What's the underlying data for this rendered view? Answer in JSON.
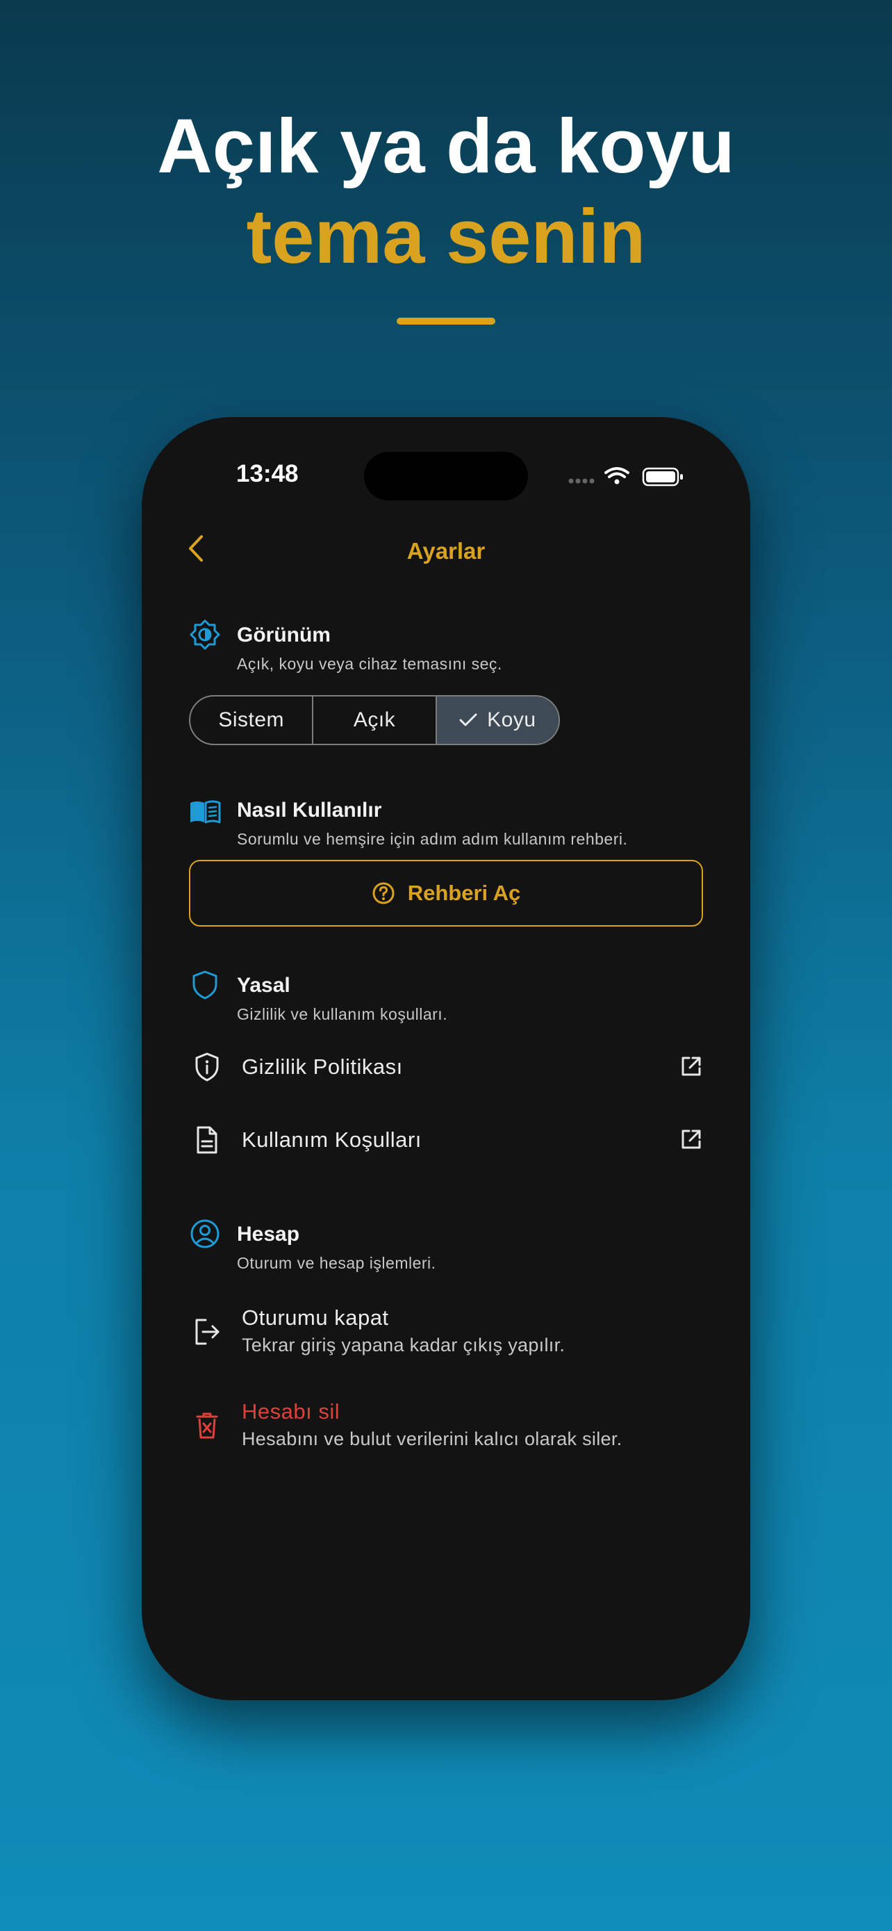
{
  "hero": {
    "line1": "Açık ya da koyu",
    "line2": "tema senin"
  },
  "status_bar": {
    "time": "13:48"
  },
  "nav": {
    "title": "Ayarlar"
  },
  "appearance": {
    "title": "Görünüm",
    "subtitle": "Açık, koyu veya cihaz temasını seç.",
    "options": [
      "Sistem",
      "Açık",
      "Koyu"
    ],
    "selected": "Koyu"
  },
  "howto": {
    "title": "Nasıl Kullanılır",
    "subtitle": "Sorumlu ve hemşire için adım adım kullanım rehberi.",
    "button": "Rehberi Aç"
  },
  "legal": {
    "title": "Yasal",
    "subtitle": "Gizlilik ve kullanım koşulları.",
    "items": [
      "Gizlilik Politikası",
      "Kullanım Koşulları"
    ]
  },
  "account": {
    "title": "Hesap",
    "subtitle": "Oturum ve hesap işlemleri.",
    "logout": {
      "label": "Oturumu kapat",
      "desc": "Tekrar giriş yapana kadar çıkış yapılır."
    },
    "delete": {
      "label": "Hesabı sil",
      "desc": "Hesabını ve bulut verilerini kalıcı olarak siler."
    }
  },
  "colors": {
    "accent": "#d9a21f",
    "info": "#1e9bd7",
    "danger": "#e0403a",
    "background": "#131314"
  }
}
